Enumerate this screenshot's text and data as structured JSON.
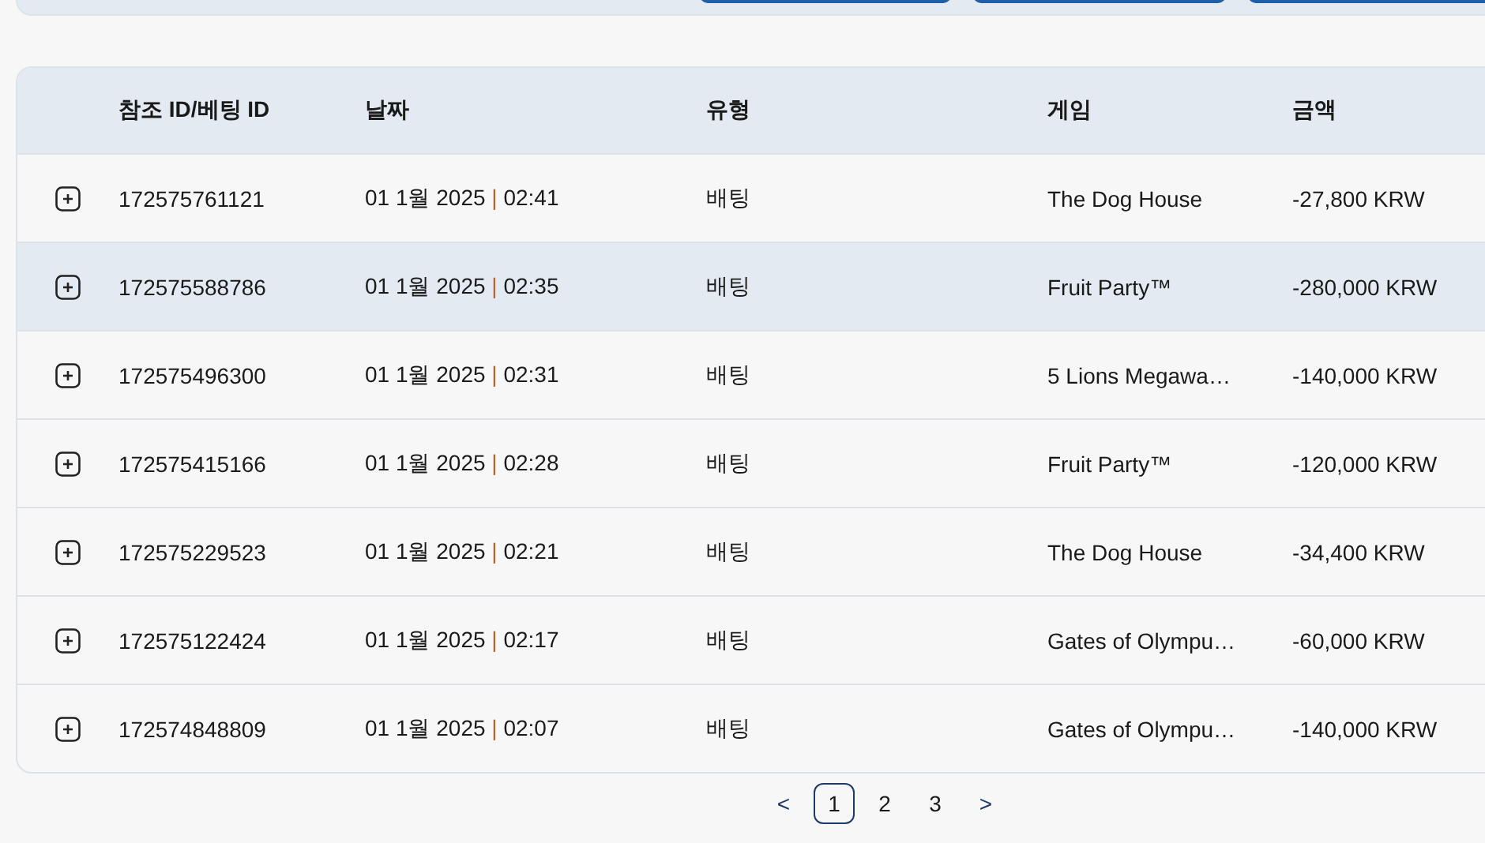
{
  "table": {
    "columns": [
      "참조 ID/베팅 ID",
      "날짜",
      "유형",
      "게임",
      "금액"
    ],
    "rows": [
      {
        "expanded": false,
        "selected": false,
        "id": "172575761121",
        "date": "01 1월 2025",
        "separator": "|",
        "time": "02:41",
        "type": "배팅",
        "game": "The Dog House",
        "amount": "-27,800 KRW"
      },
      {
        "expanded": false,
        "selected": true,
        "id": "172575588786",
        "date": "01 1월 2025",
        "separator": "|",
        "time": "02:35",
        "type": "배팅",
        "game": "Fruit Party™",
        "amount": "-280,000 KRW"
      },
      {
        "expanded": false,
        "selected": false,
        "id": "172575496300",
        "date": "01 1월 2025",
        "separator": "|",
        "time": "02:31",
        "type": "배팅",
        "game": "5 Lions Megawa…",
        "amount": "-140,000 KRW"
      },
      {
        "expanded": false,
        "selected": false,
        "id": "172575415166",
        "date": "01 1월 2025",
        "separator": "|",
        "time": "02:28",
        "type": "배팅",
        "game": "Fruit Party™",
        "amount": "-120,000 KRW"
      },
      {
        "expanded": false,
        "selected": false,
        "id": "172575229523",
        "date": "01 1월 2025",
        "separator": "|",
        "time": "02:21",
        "type": "배팅",
        "game": "The Dog House",
        "amount": "-34,400 KRW"
      },
      {
        "expanded": false,
        "selected": false,
        "id": "172575122424",
        "date": "01 1월 2025",
        "separator": "|",
        "time": "02:17",
        "type": "배팅",
        "game": "Gates of Olympu…",
        "amount": "-60,000 KRW"
      },
      {
        "expanded": false,
        "selected": false,
        "id": "172574848809",
        "date": "01 1월 2025",
        "separator": "|",
        "time": "02:07",
        "type": "배팅",
        "game": "Gates of Olympu…",
        "amount": "-140,000 KRW"
      }
    ]
  },
  "pagination": {
    "previous": "<",
    "pages": [
      {
        "label": "1",
        "selected": true
      },
      {
        "label": "2",
        "selected": false
      },
      {
        "label": "3",
        "selected": false
      }
    ],
    "next": ">"
  }
}
